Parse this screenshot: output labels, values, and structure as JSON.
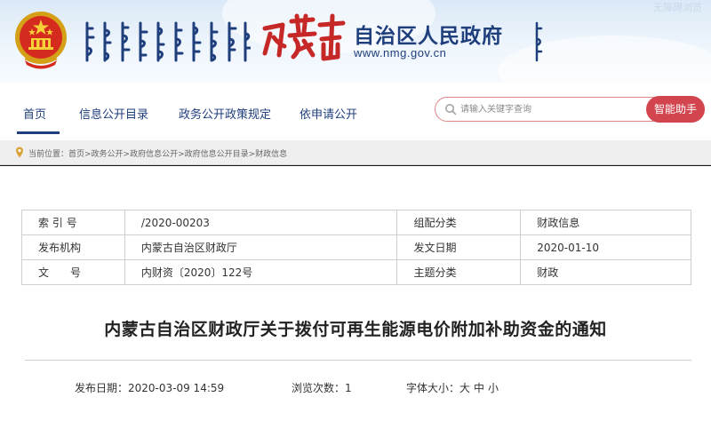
{
  "banner": {
    "accessibility_label": "无障碍浏览",
    "calligraphy": "内蒙古",
    "title": "自治区人民政府",
    "url": "www.nmg.gov.cn"
  },
  "nav": {
    "items": [
      {
        "label": "首页",
        "active": true
      },
      {
        "label": "信息公开目录",
        "active": false
      },
      {
        "label": "政务公开政策规定",
        "active": false
      },
      {
        "label": "依申请公开",
        "active": false
      }
    ],
    "search_placeholder": "请输入关键字查询",
    "assistant_button": "智能助手"
  },
  "breadcrumb": "当前位置：首页>政务公开>政府信息公开>政府信息公开目录>财政信息",
  "info_table": {
    "rows": [
      {
        "label1": "索 引 号",
        "value1": "/2020-00203",
        "label2": "组配分类",
        "value2": "财政信息"
      },
      {
        "label1": "发布机构",
        "value1": "内蒙古自治区财政厅",
        "label2": "发文日期",
        "value2": "2020-01-10"
      },
      {
        "label1": "文　　号",
        "value1": "内财资〔2020〕122号",
        "label2": "主题分类",
        "value2": "财政"
      }
    ]
  },
  "article": {
    "title": "内蒙古自治区财政厅关于拨付可再生能源电价附加补助资金的通知"
  },
  "meta": {
    "publish_label": "发布日期：2020-03-09 14:59",
    "views_label": "浏览次数：1",
    "font_size_label": "字体大小：",
    "font_large": "大",
    "font_medium": "中",
    "font_small": "小"
  },
  "colors": {
    "brand_blue": "#1f3e7c",
    "accent_red": "#d2454e",
    "calligraphy_red": "#c62828"
  }
}
